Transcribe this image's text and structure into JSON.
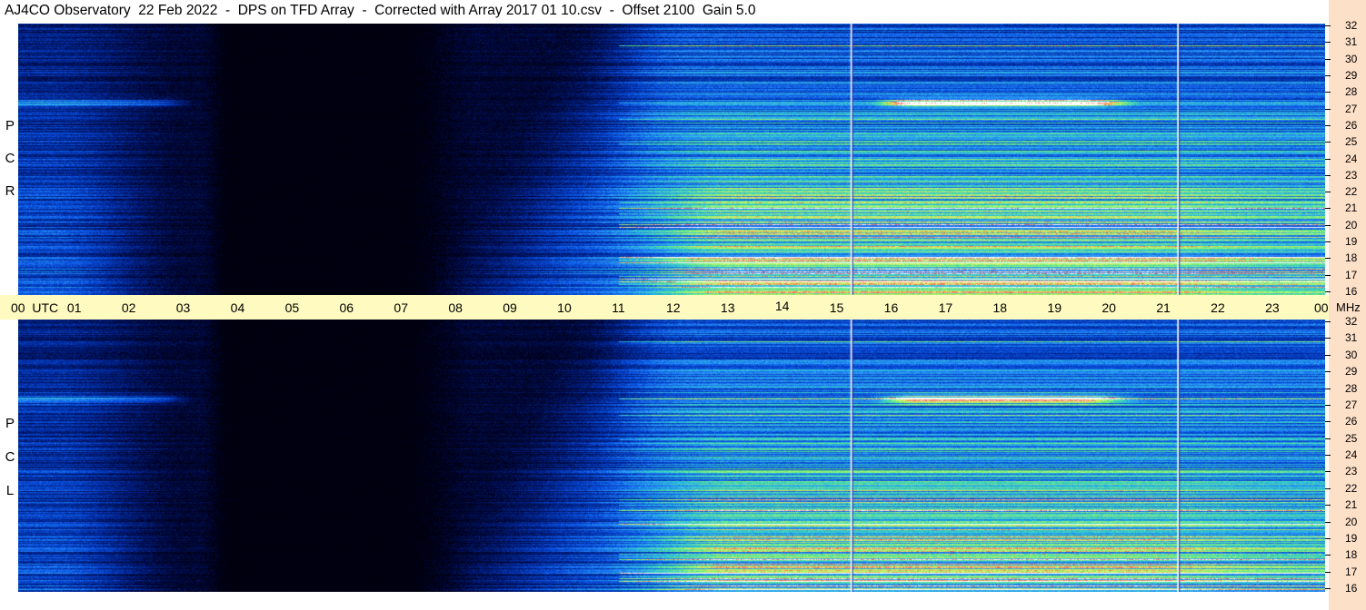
{
  "title": "AJ4CO Observatory  22 Feb 2022  -  DPS on TFD Array  -  Corrected with Array 2017 01 10.csv  -  Offset 2100  Gain 5.0",
  "colors": {
    "background": "#ffffff",
    "time_axis_bg": "#fffbc0",
    "freq_axis_bg": "#fde0c8",
    "colormap": [
      "#000010",
      "#001a6e",
      "#0a55e0",
      "#2e9cf0",
      "#38d0c8",
      "#8ff07a",
      "#e8f060",
      "#ff4050",
      "#ffffff"
    ]
  },
  "panels": [
    {
      "id": "rcp",
      "label_letters": [
        "P",
        "C",
        "R"
      ]
    },
    {
      "id": "lcp",
      "label_letters": [
        "P",
        "C",
        "L"
      ]
    }
  ],
  "time_axis": {
    "tick_labels": [
      "00  UTC",
      "01",
      "02",
      "03",
      "04",
      "05",
      "06",
      "07",
      "08",
      "09",
      "10",
      "11",
      "12",
      "13",
      "14",
      "15",
      "16",
      "17",
      "18",
      "19",
      "20",
      "21",
      "22",
      "23",
      "00"
    ]
  },
  "freq_axis": {
    "unit": "MHz",
    "tick_labels": [
      "32",
      "31",
      "30",
      "29",
      "28",
      "27",
      "26",
      "25",
      "24",
      "23",
      "22",
      "21",
      "20",
      "19",
      "18",
      "17",
      "16"
    ]
  },
  "chart_data": {
    "type": "heatmap",
    "title": "AJ4CO Observatory  22 Feb 2022  -  DPS on TFD Array  -  Corrected with Array 2017 01 10.csv  -  Offset 2100  Gain 5.0",
    "xlabel": "UTC",
    "ylabel": "MHz",
    "xlim": [
      0,
      24
    ],
    "ylim": [
      16,
      32
    ],
    "x_ticks": [
      "00",
      "01",
      "02",
      "03",
      "04",
      "05",
      "06",
      "07",
      "08",
      "09",
      "10",
      "11",
      "12",
      "13",
      "14",
      "15",
      "16",
      "17",
      "18",
      "19",
      "20",
      "21",
      "22",
      "23",
      "00"
    ],
    "y_ticks": [
      32,
      31,
      30,
      29,
      28,
      27,
      26,
      25,
      24,
      23,
      22,
      21,
      20,
      19,
      18,
      17,
      16
    ],
    "series": [
      {
        "name": "R C P",
        "values": []
      },
      {
        "name": "L C P",
        "values": []
      }
    ],
    "vertical_markers_utc": [
      15.3,
      21.3
    ]
  }
}
